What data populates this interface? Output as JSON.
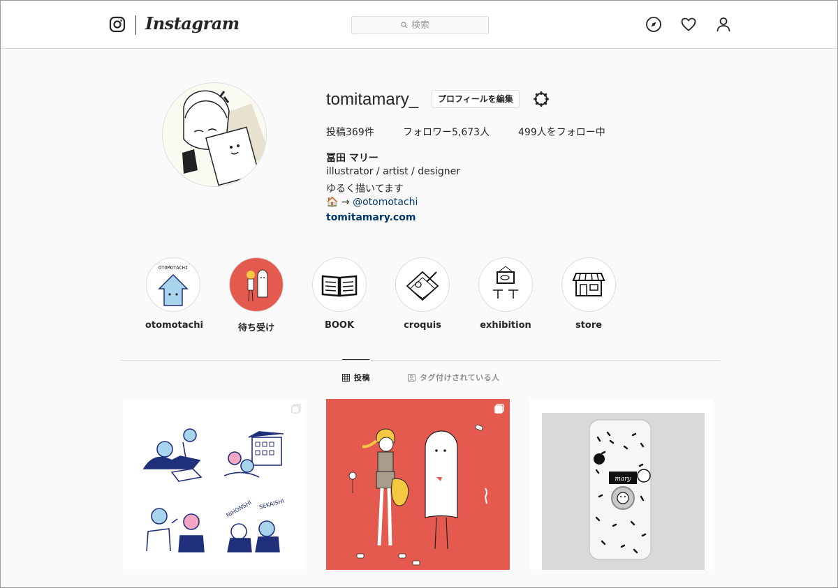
{
  "header": {
    "logo_text": "Instagram",
    "search_placeholder": "検索"
  },
  "profile": {
    "username": "tomitamary_",
    "edit_button": "プロフィールを編集",
    "stats": {
      "posts": "投稿369件",
      "followers": "フォロワー5,673人",
      "following": "499人をフォロー中"
    },
    "full_name": "冨田 マリー",
    "bio": [
      "illustrator / artist / designer",
      "ゆるく描いてます"
    ],
    "bio_link_prefix": "🏠 →",
    "bio_link": "@otomotachi",
    "website": "tomitamary.com"
  },
  "highlights": [
    {
      "label": "otomotachi",
      "icon": "house-character-icon"
    },
    {
      "label": "待ち受け",
      "icon": "ghost-girl-icon"
    },
    {
      "label": "BOOK",
      "icon": "open-book-icon"
    },
    {
      "label": "croquis",
      "icon": "sketchbook-icon"
    },
    {
      "label": "exhibition",
      "icon": "framed-picture-icon"
    },
    {
      "label": "store",
      "icon": "storefront-icon"
    }
  ],
  "tabs": {
    "posts": "投稿",
    "tagged": "タグ付けされている人"
  },
  "colors": {
    "accent_red": "#e55a4e",
    "link_blue": "#00376b",
    "illustration_navy": "#1f2f7a"
  }
}
